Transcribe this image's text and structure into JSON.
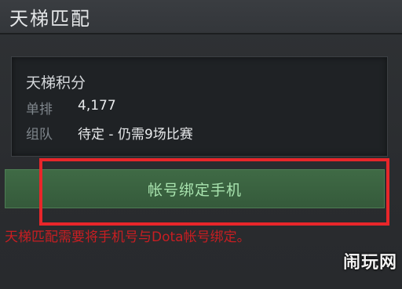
{
  "header": {
    "title": "天梯匹配"
  },
  "rank_panel": {
    "title": "天梯积分",
    "rows": [
      {
        "label": "单排",
        "value": "4,177"
      },
      {
        "label": "组队",
        "value": "待定 - 仍需9场比赛"
      }
    ]
  },
  "bind_button": {
    "label": "帐号绑定手机"
  },
  "notice": {
    "text": "天梯匹配需要将手机号与Dota帐号绑定。"
  },
  "watermark": {
    "text": "闹玩网"
  },
  "colors": {
    "highlight_border": "#e8262a",
    "button_bg": "#3f6a45",
    "notice_text": "#c81e22"
  }
}
